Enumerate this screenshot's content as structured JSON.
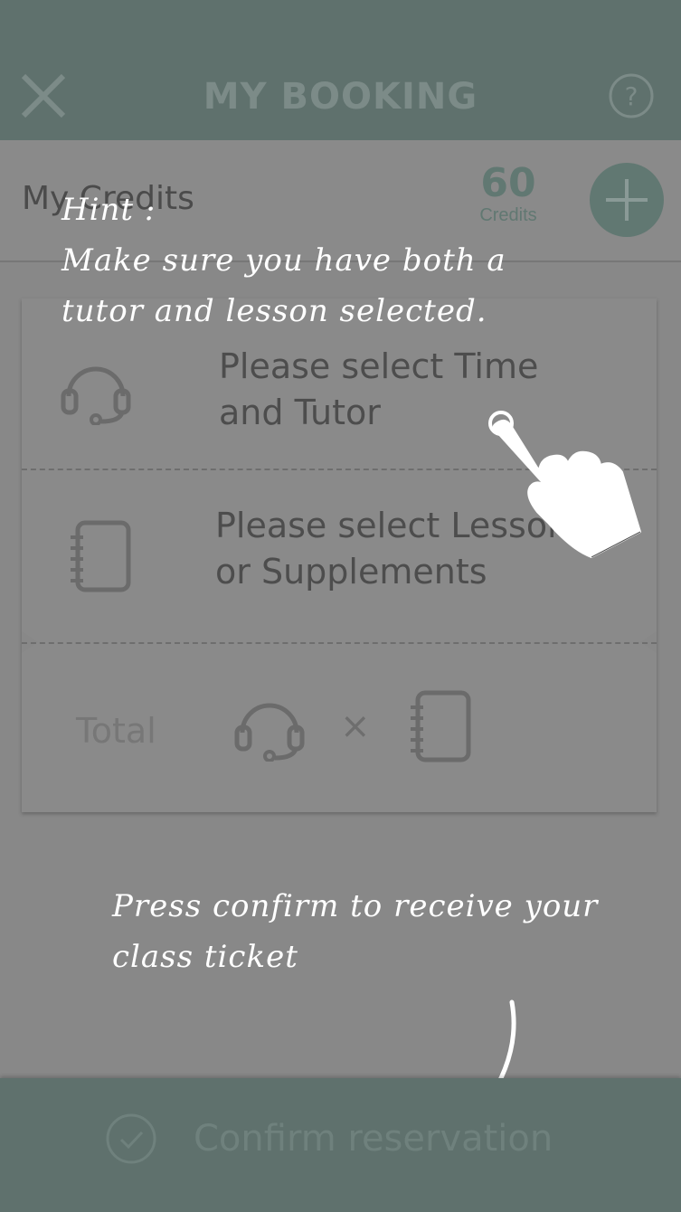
{
  "header": {
    "title": "MY BOOKING"
  },
  "credits": {
    "label": "My Credits",
    "amount": "60",
    "unit": "Credits"
  },
  "booking": {
    "tutor_prompt": [
      "Please select Time",
      "and Tutor"
    ],
    "lesson_prompt": [
      "Please select Lesson",
      "or Supplements"
    ],
    "total_label": "Total",
    "times_symbol": "×"
  },
  "hints": {
    "top": [
      "Hint :",
      "Make sure you have both a",
      "tutor and lesson selected."
    ],
    "bottom": [
      "Press confirm to receive your",
      "class ticket"
    ]
  },
  "footer": {
    "confirm_label": "Confirm reservation"
  },
  "colors": {
    "header": "#5f716d",
    "overlay": "#888888",
    "accent": "#617872",
    "hint_text": "#ffffff"
  },
  "icons": [
    "close-icon",
    "help-icon",
    "plus-icon",
    "headset-icon",
    "notebook-icon",
    "checkmark-circle-icon",
    "pointing-hand-icon",
    "arrow-down-icon"
  ]
}
